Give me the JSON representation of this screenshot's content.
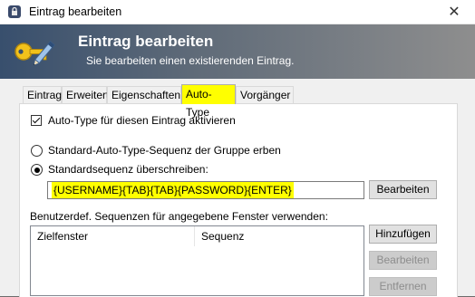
{
  "window": {
    "title": "Eintrag bearbeiten",
    "close_symbol": "✕"
  },
  "banner": {
    "heading": "Eintrag bearbeiten",
    "subtitle": "Sie bearbeiten einen existierenden Eintrag.",
    "icon": "key-pencil-icon"
  },
  "tabs": [
    {
      "label": "Eintrag",
      "active": false
    },
    {
      "label": "Erweitert",
      "active": false
    },
    {
      "label": "Eigenschaften",
      "active": false
    },
    {
      "label": "Auto-Type",
      "active": true
    },
    {
      "label": "Vorgänger",
      "active": false
    }
  ],
  "autotype": {
    "enable_checkbox_label": "Auto-Type für diesen Eintrag aktivieren",
    "enable_checked": true,
    "radio_inherit_label": "Standard-Auto-Type-Sequenz der Gruppe erben",
    "radio_override_label": "Standardsequenz überschreiben:",
    "selected_radio": "override",
    "sequence_value": "{USERNAME}{TAB}{TAB}{PASSWORD}{ENTER}",
    "edit_button": "Bearbeiten",
    "custom_sequences_label": "Benutzerdef. Sequenzen für angegebene Fenster verwenden:",
    "list_columns": [
      "Zielfenster",
      "Sequenz"
    ],
    "add_button": "Hinzufügen",
    "edit_button_2": "Bearbeiten",
    "remove_button": "Entfernen"
  },
  "colors": {
    "highlight": "#ffff00",
    "banner_left": "#384f6d",
    "banner_right": "#8e8e8e"
  }
}
